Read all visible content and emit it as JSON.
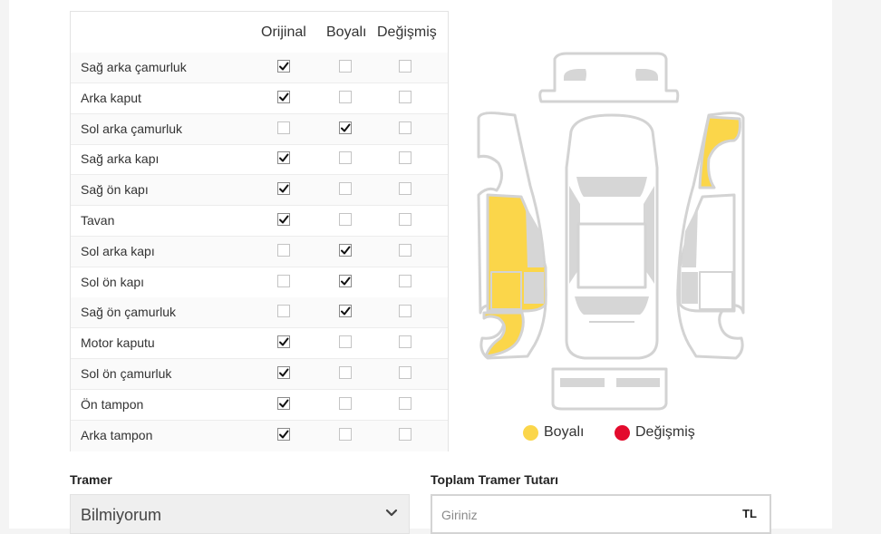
{
  "table": {
    "columns": [
      "Orijinal",
      "Boyalı",
      "Değişmiş"
    ],
    "rows": [
      {
        "label": "Sağ arka çamurluk",
        "state": "Orijinal"
      },
      {
        "label": "Arka kaput",
        "state": "Orijinal"
      },
      {
        "label": "Sol arka çamurluk",
        "state": "Boyalı"
      },
      {
        "label": "Sağ arka kapı",
        "state": "Orijinal"
      },
      {
        "label": "Sağ ön kapı",
        "state": "Orijinal"
      },
      {
        "label": "Tavan",
        "state": "Orijinal"
      },
      {
        "label": "Sol arka kapı",
        "state": "Boyalı"
      },
      {
        "label": "Sol ön kapı",
        "state": "Boyalı"
      },
      {
        "label": "Sağ ön çamurluk",
        "state": "Boyalı"
      },
      {
        "label": "Motor kaputu",
        "state": "Orijinal"
      },
      {
        "label": "Sol ön çamurluk",
        "state": "Orijinal"
      },
      {
        "label": "Ön tampon",
        "state": "Orijinal"
      },
      {
        "label": "Arka tampon",
        "state": "Orijinal"
      }
    ]
  },
  "legend": {
    "painted_label": "Boyalı",
    "changed_label": "Değişmiş",
    "painted_color": "#fbd64a",
    "changed_color": "#e30b2d"
  },
  "colors": {
    "part_fill": "#ffffff",
    "part_stroke": "#d3d3d3",
    "glass": "#d6d6d6"
  },
  "tramer": {
    "label": "Tramer",
    "value": "Bilmiyorum",
    "chevron_icon": "chevron-down-icon"
  },
  "total": {
    "label": "Toplam Tramer Tutarı",
    "placeholder": "Giriniz",
    "value": "",
    "suffix": "TL"
  }
}
